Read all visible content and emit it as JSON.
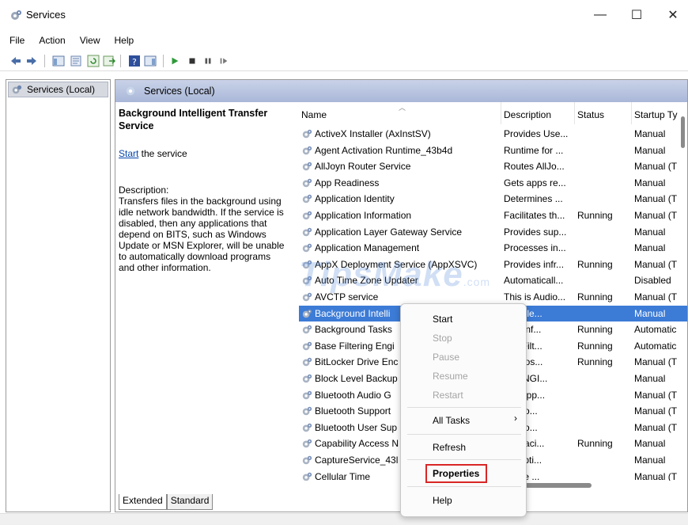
{
  "window": {
    "title": "Services",
    "min_glyph": "—",
    "max_glyph": "☐",
    "close_glyph": "✕"
  },
  "menu": [
    "File",
    "Action",
    "View",
    "Help"
  ],
  "toolbar": [
    "back-icon",
    "forward-icon",
    "show-hide-tree-icon",
    "properties-icon",
    "refresh-icon",
    "export-list-icon",
    "help-icon",
    "show-hide-action-pane-icon",
    "start-service-icon",
    "stop-service-icon",
    "pause-service-icon",
    "resume-service-icon"
  ],
  "tree": {
    "root_label": "Services (Local)"
  },
  "panel": {
    "header": "Services (Local)",
    "desc": {
      "title": "Background Intelligent Transfer Service",
      "link_text": "Start",
      "link_suffix": " the service",
      "label": "Description:",
      "body": "Transfers files in the background using idle network bandwidth. If the service is disabled, then any applications that depend on BITS, such as Windows Update or MSN Explorer, will be unable to automatically download programs and other information."
    }
  },
  "table": {
    "headers": {
      "name": "Name",
      "description": "Description",
      "status": "Status",
      "startup": "Startup Ty"
    },
    "rows": [
      {
        "name": "ActiveX Installer (AxInstSV)",
        "description": "Provides Use...",
        "status": "",
        "startup": "Manual"
      },
      {
        "name": "Agent Activation Runtime_43b4d",
        "description": "Runtime for ...",
        "status": "",
        "startup": "Manual"
      },
      {
        "name": "AllJoyn Router Service",
        "description": "Routes AllJo...",
        "status": "",
        "startup": "Manual (T"
      },
      {
        "name": "App Readiness",
        "description": "Gets apps re...",
        "status": "",
        "startup": "Manual"
      },
      {
        "name": "Application Identity",
        "description": "Determines ...",
        "status": "",
        "startup": "Manual (T"
      },
      {
        "name": "Application Information",
        "description": "Facilitates th...",
        "status": "Running",
        "startup": "Manual (T"
      },
      {
        "name": "Application Layer Gateway Service",
        "description": "Provides sup...",
        "status": "",
        "startup": "Manual"
      },
      {
        "name": "Application Management",
        "description": "Processes in...",
        "status": "",
        "startup": "Manual"
      },
      {
        "name": "AppX Deployment Service (AppXSVC)",
        "description": "Provides infr...",
        "status": "Running",
        "startup": "Manual (T"
      },
      {
        "name": "Auto Time Zone Updater",
        "description": "Automaticall...",
        "status": "",
        "startup": "Disabled"
      },
      {
        "name": "AVCTP service",
        "description": "This is Audio...",
        "status": "Running",
        "startup": "Manual (T"
      },
      {
        "name": "Background Intelli",
        "description": "fers file...",
        "status": "",
        "startup": "Manual",
        "selected": true
      },
      {
        "name": "Background Tasks",
        "description": "ows inf...",
        "status": "Running",
        "startup": "Automatic"
      },
      {
        "name": "Base Filtering Engi",
        "description": "ase Filt...",
        "status": "Running",
        "startup": "Automatic"
      },
      {
        "name": "BitLocker Drive Enc",
        "description": "VC hos...",
        "status": "Running",
        "startup": "Manual (T"
      },
      {
        "name": "Block Level Backup",
        "description": "VBENGI...",
        "status": "",
        "startup": "Manual"
      },
      {
        "name": "Bluetooth Audio G",
        "description": "ce supp...",
        "status": "",
        "startup": "Manual (T"
      },
      {
        "name": "Bluetooth Support",
        "description": "luetoo...",
        "status": "",
        "startup": "Manual (T"
      },
      {
        "name": "Bluetooth User Sup",
        "description": "luetoo...",
        "status": "",
        "startup": "Manual (T"
      },
      {
        "name": "Capability Access N",
        "description": "des faci...",
        "status": "Running",
        "startup": "Manual"
      },
      {
        "name": "CaptureService_43l",
        "description": "les opti...",
        "status": "",
        "startup": "Manual"
      },
      {
        "name": "Cellular Time",
        "description": "ervice ...",
        "status": "",
        "startup": "Manual (T"
      }
    ]
  },
  "tabs": [
    "Extended",
    "Standard"
  ],
  "context_menu": {
    "start": "Start",
    "stop": "Stop",
    "pause": "Pause",
    "resume": "Resume",
    "restart": "Restart",
    "all_tasks": "All Tasks",
    "all_tasks_arrow": "›",
    "refresh": "Refresh",
    "properties": "Properties",
    "help": "Help"
  },
  "watermark": {
    "text": "TipsMake",
    "suffix": ".com"
  },
  "colors": {
    "selection": "#3c7bd6",
    "header_gradient": "#b6c3e0",
    "highlight_box": "#d92626",
    "link": "#0645ad"
  }
}
